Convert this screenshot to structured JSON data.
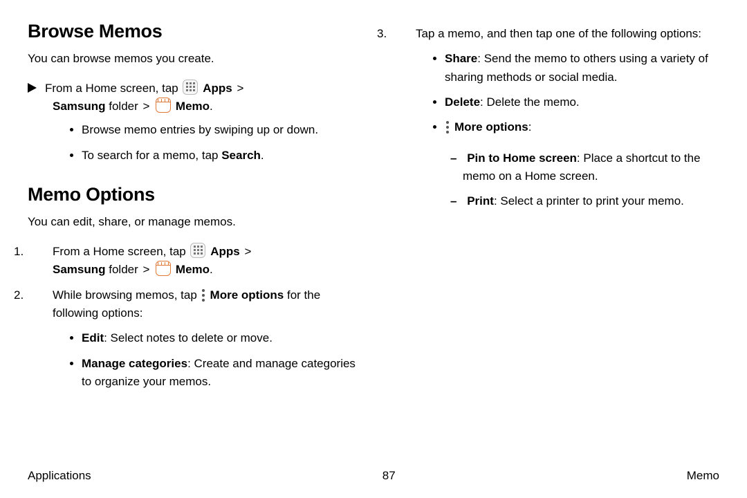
{
  "left": {
    "h_browse": "Browse Memos",
    "browse_intro": "You can browse memos you create.",
    "path_line_pre": "From a Home screen, tap ",
    "apps_label": "Apps",
    "samsung_folder": "Samsung",
    "folder_word": " folder ",
    "memo_label": "Memo",
    "browse_b1": "Browse memo entries by swiping up or down.",
    "browse_b2_pre": "To search for a memo, tap ",
    "browse_b2_bold": "Search",
    "h_options": "Memo Options",
    "options_intro": "You can edit, share, or manage memos.",
    "step1_pre": "From a Home screen, tap ",
    "step2_pre": "While browsing memos, tap ",
    "step2_more": "More options",
    "step2_post": " for the following options:",
    "opt_edit_b": "Edit",
    "opt_edit_t": ": Select notes to delete or move.",
    "opt_mc_b": "Manage categories",
    "opt_mc_t": ": Create and manage categories to organize your memos."
  },
  "right": {
    "step3": "Tap a memo, and then tap one of the following options:",
    "share_b": "Share",
    "share_t": ": Send the memo to others using a variety of sharing methods or social media.",
    "delete_b": "Delete",
    "delete_t": ": Delete the memo.",
    "more_b": "More options",
    "more_colon": ":",
    "pin_b": "Pin to Home screen",
    "pin_t": ": Place a shortcut to the memo on a Home screen.",
    "print_b": "Print",
    "print_t": ": Select a printer to print your memo."
  },
  "footer": {
    "left": "Applications",
    "center": "87",
    "right": "Memo"
  },
  "glyphs": {
    "chevron": ">",
    "period": "."
  }
}
